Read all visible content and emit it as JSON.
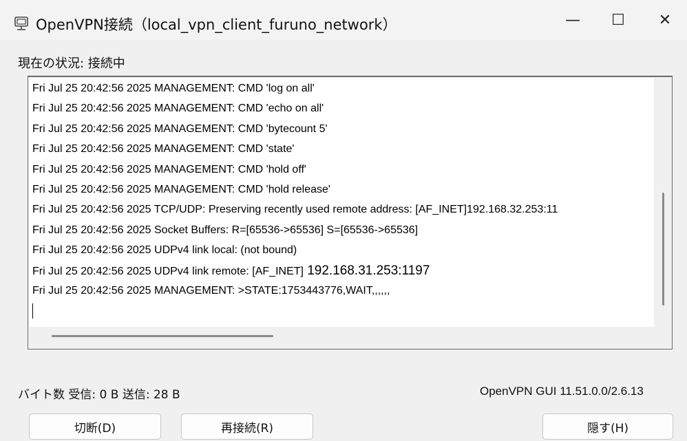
{
  "window": {
    "title": "OpenVPN接続（local_vpn_client_furuno_network）",
    "icon": "openvpn-monitor-icon",
    "controls": {
      "minimize": "—",
      "maximize": "☐",
      "close": "✕"
    }
  },
  "status": "現在の状況: 接続中",
  "log": [
    {
      "text": "Fri Jul 25 20:42:56 2025 MANAGEMENT: CMD 'log on all'"
    },
    {
      "text": "Fri Jul 25 20:42:56 2025 MANAGEMENT: CMD 'echo on all'"
    },
    {
      "text": "Fri Jul 25 20:42:56 2025 MANAGEMENT: CMD 'bytecount 5'"
    },
    {
      "text": "Fri Jul 25 20:42:56 2025 MANAGEMENT: CMD 'state'"
    },
    {
      "text": "Fri Jul 25 20:42:56 2025 MANAGEMENT: CMD 'hold off'"
    },
    {
      "text": "Fri Jul 25 20:42:56 2025 MANAGEMENT: CMD 'hold release'"
    },
    {
      "text": "Fri Jul 25 20:42:56 2025 TCP/UDP: Preserving recently used remote address: [AF_INET]192.168.32.253:11"
    },
    {
      "text": "Fri Jul 25 20:42:56 2025 Socket Buffers: R=[65536->65536] S=[65536->65536]"
    },
    {
      "text": "Fri Jul 25 20:42:56 2025 UDPv4 link local: (not bound)"
    },
    {
      "text": "Fri Jul 25 20:42:56 2025 UDPv4 link remote: [AF_INET]",
      "extra": " 192.168.31.253:1197"
    },
    {
      "text": "Fri Jul 25 20:42:56 2025 MANAGEMENT: >STATE:1753443776,WAIT,,,,,,"
    }
  ],
  "footer": {
    "stats": "バイト数 受信: 0 B  送信: 28 B",
    "version": "OpenVPN GUI 11.51.0.0/2.6.13"
  },
  "buttons": {
    "disconnect": "切断(D)",
    "reconnect": "再接続(R)",
    "hide": "隠す(H)"
  }
}
